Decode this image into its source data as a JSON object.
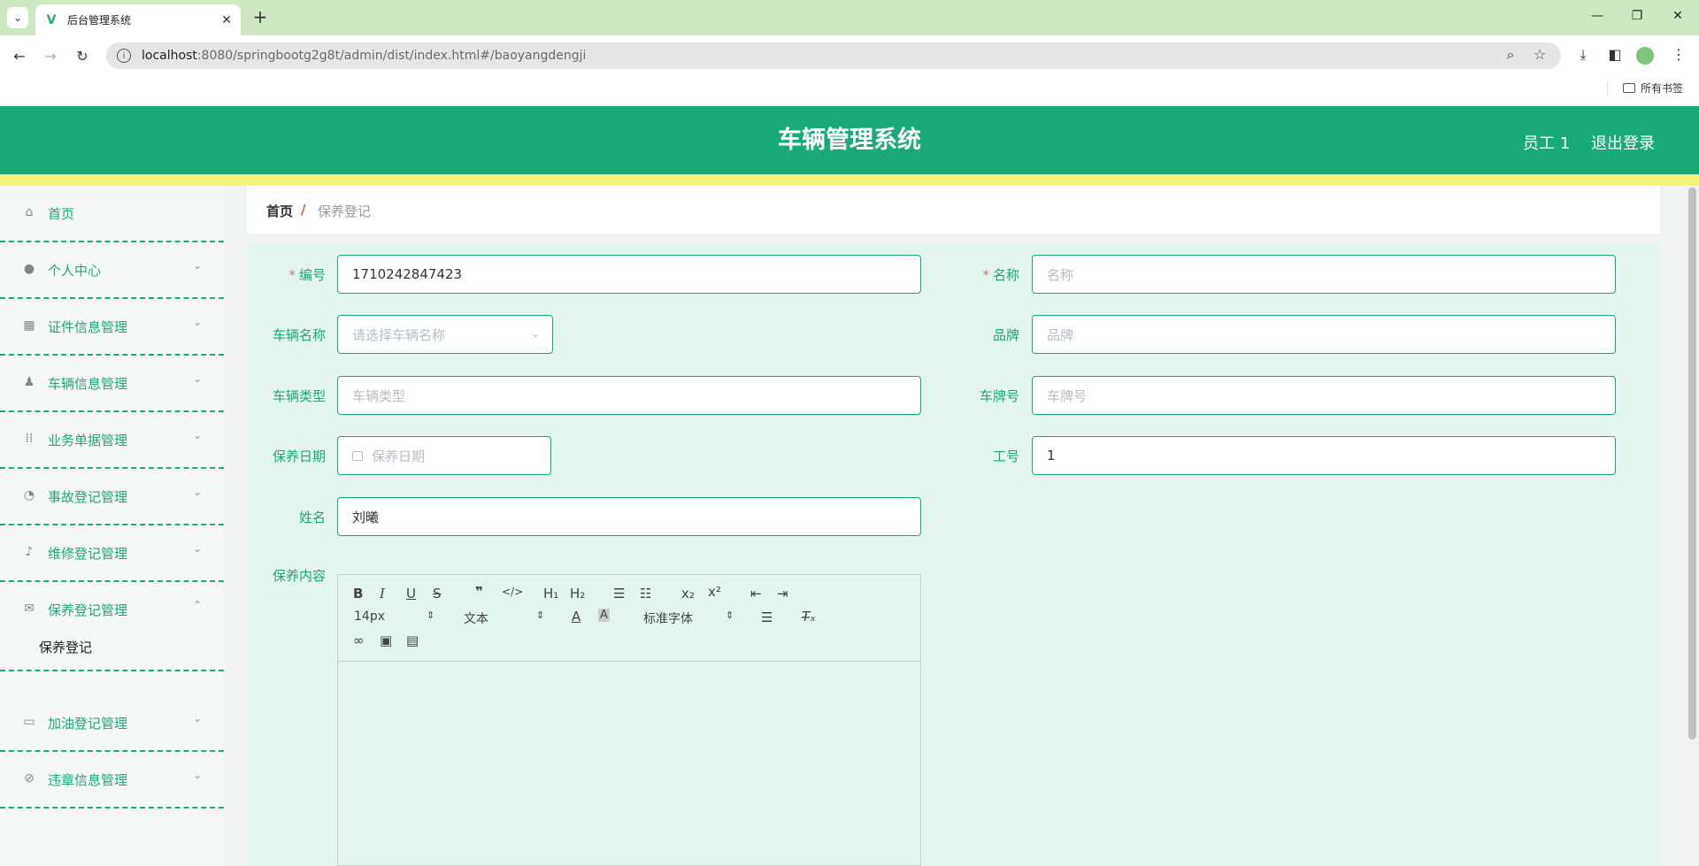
{
  "browser": {
    "tab_title": "后台管理系统",
    "url_host": "localhost",
    "url_path": ":8080/springbootg2g8t/admin/dist/index.html#/baoyangdengji",
    "bookmarks_label": "所有书签"
  },
  "header": {
    "title": "车辆管理系统",
    "user": "员工 1",
    "logout": "退出登录"
  },
  "sidebar": {
    "items": [
      {
        "label": "首页",
        "icon": "home-icon"
      },
      {
        "label": "个人中心",
        "icon": "user-icon"
      },
      {
        "label": "证件信息管理",
        "icon": "grid-icon"
      },
      {
        "label": "车辆信息管理",
        "icon": "person-icon"
      },
      {
        "label": "业务单据管理",
        "icon": "apps-icon"
      },
      {
        "label": "事故登记管理",
        "icon": "gauge-icon"
      },
      {
        "label": "维修登记管理",
        "icon": "mic-icon"
      },
      {
        "label": "保养登记管理",
        "icon": "mail-icon"
      },
      {
        "label": "加油登记管理",
        "icon": "chat-icon"
      },
      {
        "label": "违章信息管理",
        "icon": "compass-icon"
      }
    ],
    "submenu_active": "保养登记"
  },
  "breadcrumb": {
    "home": "首页",
    "separator": "/",
    "current": "保养登记"
  },
  "form": {
    "bianhao_label": "编号",
    "bianhao_value": "1710242847423",
    "mingcheng_label": "名称",
    "mingcheng_placeholder": "名称",
    "cheliangmingcheng_label": "车辆名称",
    "cheliangmingcheng_placeholder": "请选择车辆名称",
    "pinpai_label": "品牌",
    "pinpai_placeholder": "品牌",
    "cheliangleixing_label": "车辆类型",
    "cheliangleixing_placeholder": "车辆类型",
    "chepaihao_label": "车牌号",
    "chepaihao_placeholder": "车牌号",
    "baoyangriqi_label": "保养日期",
    "baoyangriqi_placeholder": "保养日期",
    "gonghao_label": "工号",
    "gonghao_value": "1",
    "xingming_label": "姓名",
    "xingming_value": "刘曦",
    "baoyangneirong_label": "保养内容"
  },
  "editor": {
    "font_size": "14px",
    "heading": "文本",
    "font_family": "标准字体"
  },
  "colors": {
    "primary": "#1aa979",
    "accent_bar": "#f4f77c",
    "form_bg": "#e3f5ee",
    "required": "#f56c6c"
  }
}
